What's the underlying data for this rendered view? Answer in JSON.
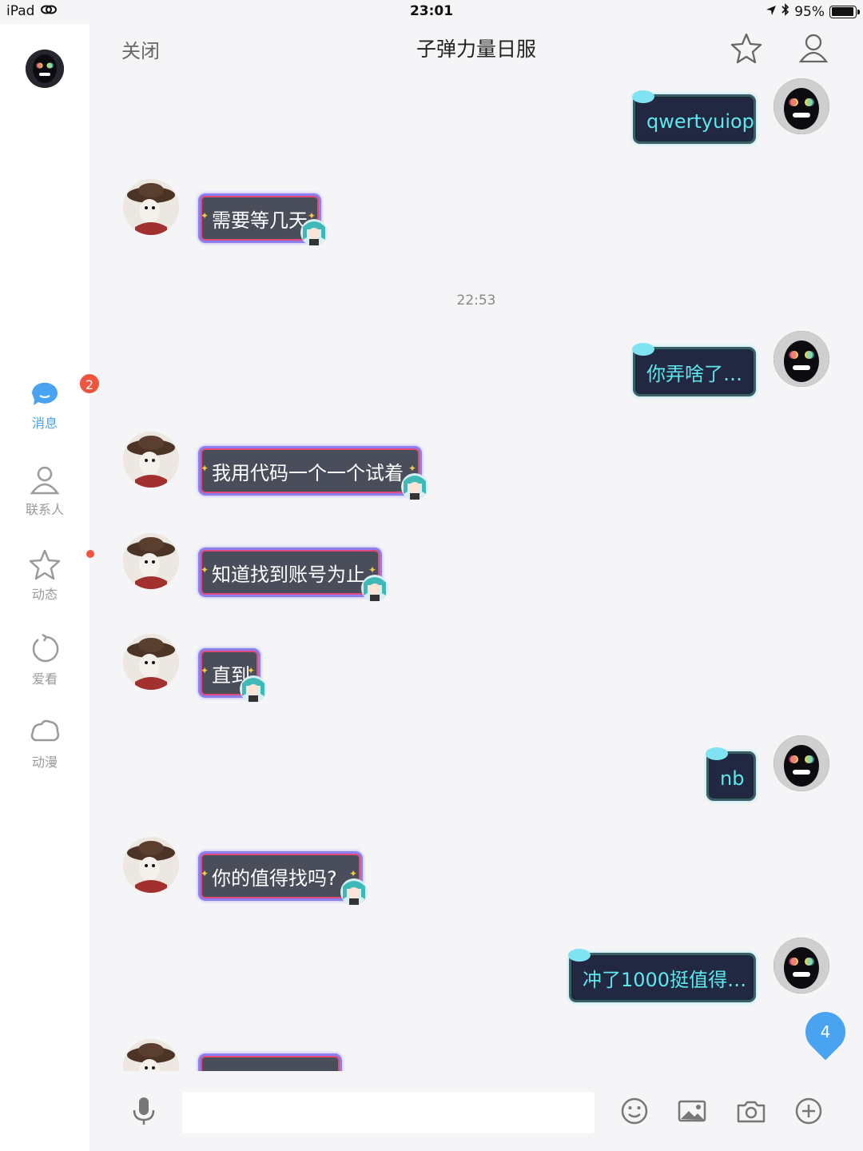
{
  "status_bar": {
    "device": "iPad",
    "time": "23:01",
    "battery": "95%"
  },
  "sidebar": {
    "items": [
      {
        "label": "消息",
        "badge": "2"
      },
      {
        "label": "联系人"
      },
      {
        "label": "动态"
      },
      {
        "label": "爱看"
      },
      {
        "label": "动漫"
      }
    ]
  },
  "header": {
    "close_label": "关闭",
    "title": "子弹力量日服"
  },
  "chat": {
    "messages": [
      {
        "from": "me",
        "text": "qwertyuiop"
      },
      {
        "from": "other",
        "text": "需要等几天"
      },
      {
        "from": "me",
        "text": "你弄啥了…"
      },
      {
        "from": "other",
        "text": "我用代码一个一个试着"
      },
      {
        "from": "other",
        "text": "知道找到账号为止"
      },
      {
        "from": "other",
        "text": "直到"
      },
      {
        "from": "me",
        "text": "nb"
      },
      {
        "from": "other",
        "text": "你的值得找吗?"
      },
      {
        "from": "me",
        "text": "冲了1000挺值得…"
      }
    ],
    "timestamp": "22:53",
    "unread_count": "4"
  },
  "input": {
    "placeholder": ""
  },
  "colors": {
    "accent": "#4aa3f0",
    "badge": "#f0543e",
    "bubble_other": "#4a4d5a",
    "bubble_me": "#232842",
    "bubble_me_text": "#5de8ec"
  }
}
